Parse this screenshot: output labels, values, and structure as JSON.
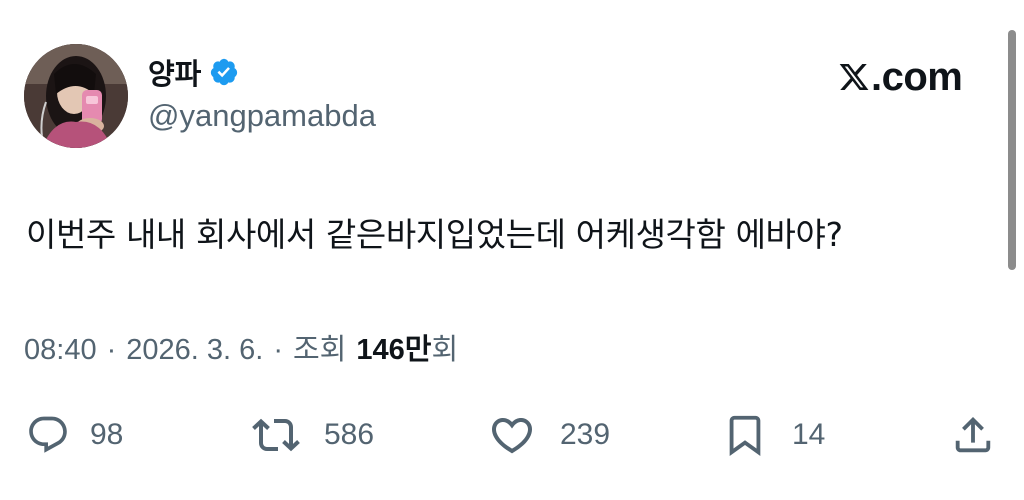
{
  "author": {
    "display_name": "양파",
    "handle": "@yangpamabda",
    "verified": true,
    "verified_color": "#1d9bf0"
  },
  "brand": {
    "label": ".com",
    "icon": "x-logo-icon"
  },
  "tweet": {
    "text": "이번주 내내 회사에서 같은바지입었는데 어케생각함 에바야?"
  },
  "meta": {
    "time": "08:40",
    "separator": "·",
    "date": "2026. 3. 6.",
    "views_prefix": "조회",
    "views_count": "146만",
    "views_suffix": "회"
  },
  "actions": {
    "reply": {
      "icon": "reply-icon",
      "count": "98"
    },
    "repost": {
      "icon": "repost-icon",
      "count": "586"
    },
    "like": {
      "icon": "heart-icon",
      "count": "239"
    },
    "bookmark": {
      "icon": "bookmark-icon",
      "count": "14"
    },
    "share": {
      "icon": "share-icon"
    }
  },
  "colors": {
    "text_primary": "#0f1419",
    "text_secondary": "#536471",
    "background": "#ffffff"
  }
}
